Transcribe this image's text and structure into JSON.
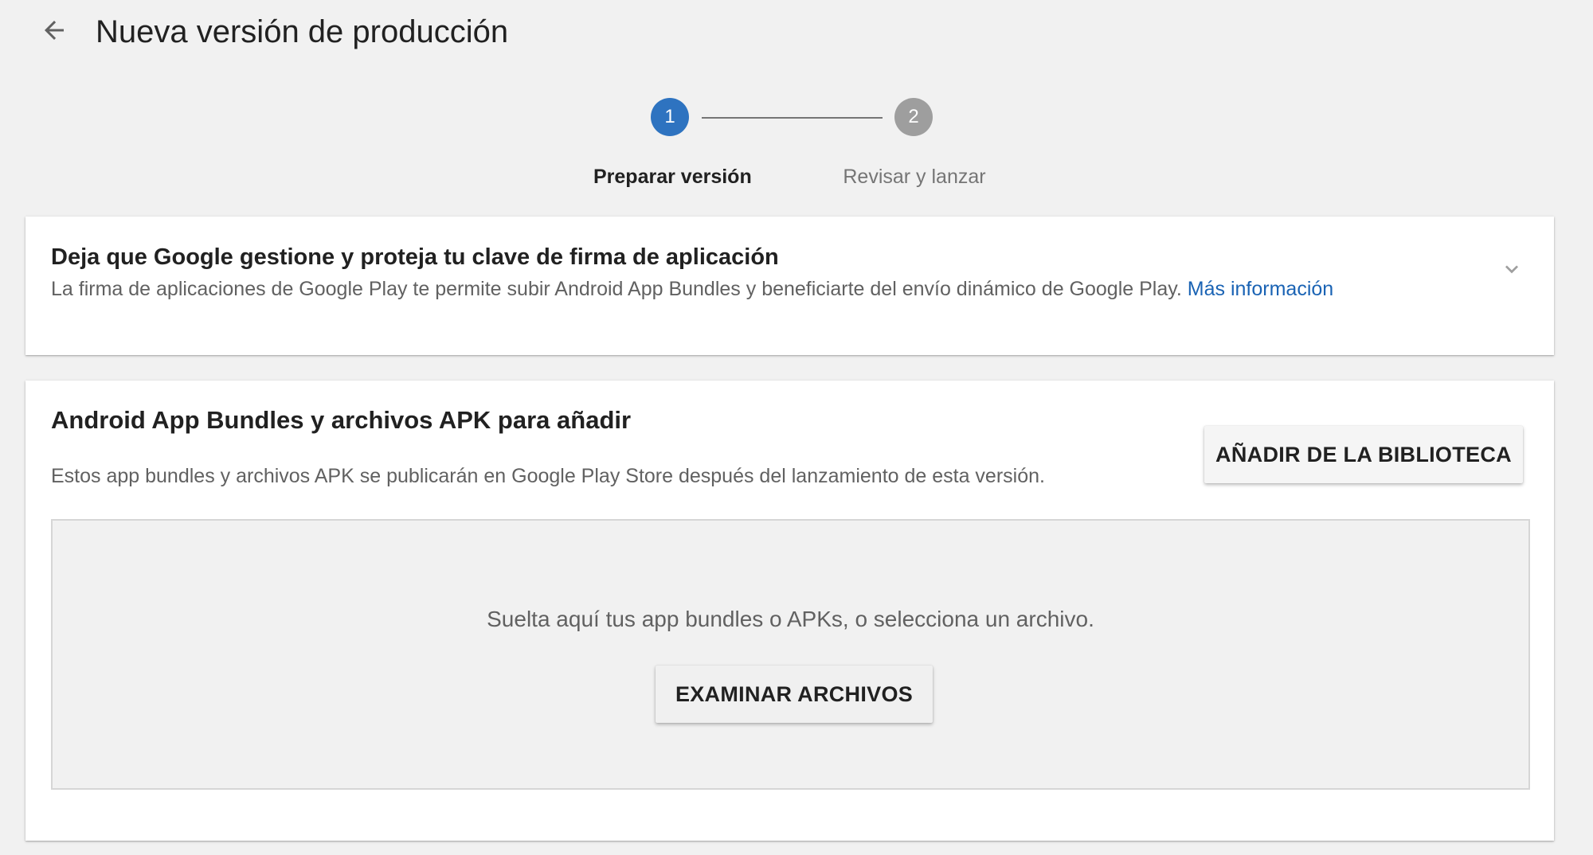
{
  "header": {
    "title": "Nueva versión de producción",
    "back_icon": "arrow-back-icon"
  },
  "stepper": {
    "current_step": 1,
    "steps": [
      {
        "number": "1",
        "label": "Preparar versión",
        "state": "active",
        "color": "#2e73c0"
      },
      {
        "number": "2",
        "label": "Revisar y lanzar",
        "state": "inactive",
        "color": "#9e9e9e"
      }
    ]
  },
  "signing_card": {
    "title": "Deja que Google gestione y proteja tu clave de firma de aplicación",
    "description": "La firma de aplicaciones de Google Play te permite subir Android App Bundles y beneficiarte del envío dinámico de Google Play.",
    "link_label": "Más información",
    "link_color": "#1a63b4",
    "expand_icon": "chevron-down-icon"
  },
  "bundles_card": {
    "title": "Android App Bundles y archivos APK para añadir",
    "description": "Estos app bundles y archivos APK se publicarán en Google Play Store después del lanzamiento de esta versión.",
    "add_from_library_label": "AÑADIR DE LA BIBLIOTECA",
    "dropzone": {
      "text": "Suelta aquí tus app bundles o APKs, o selecciona un archivo.",
      "browse_label": "EXAMINAR ARCHIVOS"
    }
  }
}
